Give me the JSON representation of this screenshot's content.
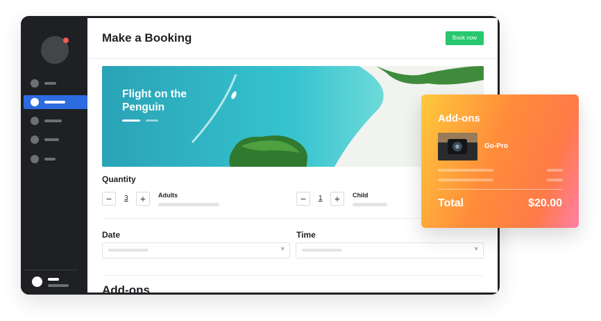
{
  "header": {
    "title": "Make a Booking",
    "book_label": "Book now"
  },
  "hero": {
    "title": "Flight on the Penguin"
  },
  "quantity": {
    "label": "Quantity",
    "adults": {
      "value": "3",
      "label": "Adults",
      "minus": "−",
      "plus": "+"
    },
    "child": {
      "value": "1",
      "label": "Child",
      "minus": "−",
      "plus": "+"
    }
  },
  "date": {
    "label": "Date",
    "chevron": "˅"
  },
  "time": {
    "label": "Time",
    "chevron": "˅"
  },
  "addons_section": {
    "heading": "Add-ons"
  },
  "addons_card": {
    "title": "Add-ons",
    "item_name": "Go-Pro",
    "total_label": "Total",
    "total_value": "$20.00"
  },
  "colors": {
    "sidebar": "#1f2023",
    "active_nav": "#2d6cdf",
    "book_button": "#28c76f",
    "notification_dot": "#f05a5a",
    "card_gradient": [
      "#ffc93c",
      "#ff8c3a",
      "#ff7fa8"
    ]
  },
  "icons": {
    "avatar": "avatar",
    "chevron": "chevron-down-icon",
    "minus": "minus-icon",
    "plus": "plus-icon"
  }
}
